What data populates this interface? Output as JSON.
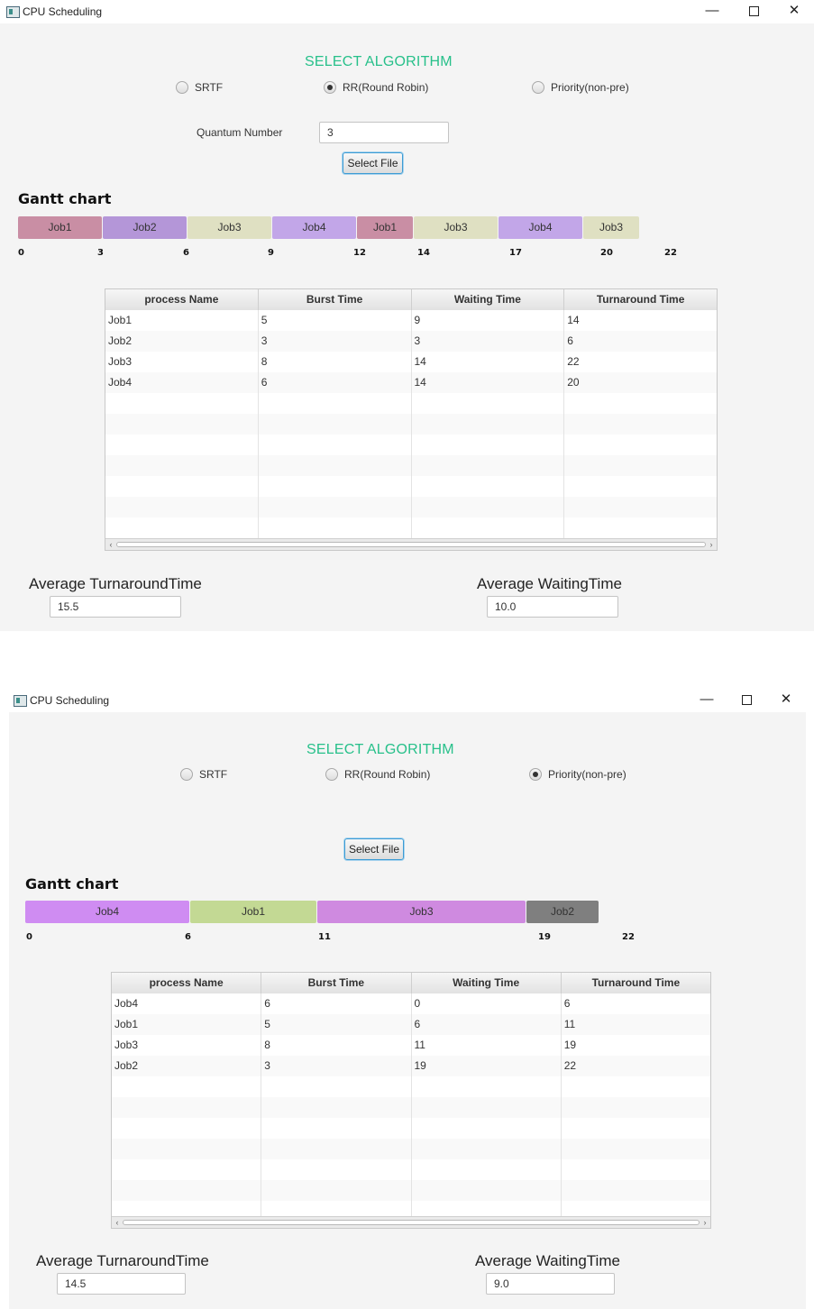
{
  "windows": [
    {
      "title": "CPU Scheduling",
      "select_title": "SELECT ALGORITHM",
      "radios": [
        {
          "label": "SRTF",
          "selected": false
        },
        {
          "label": "RR(Round Robin)",
          "selected": true
        },
        {
          "label": "Priority(non-pre)",
          "selected": false
        }
      ],
      "quantum_label": "Quantum Number",
      "quantum_value": "3",
      "select_file_label": "Select File",
      "gantt_title": "Gantt chart",
      "gantt_blocks": [
        "Job1",
        "Job2",
        "Job3",
        "Job4",
        "Job1",
        "Job3",
        "Job4",
        "Job3"
      ],
      "gantt_ticks": [
        "0",
        "3",
        "6",
        "9",
        "12",
        "14",
        "17",
        "20",
        "22"
      ],
      "table_headers": [
        "process Name",
        "Burst Time",
        "Waiting Time",
        "Turnaround Time"
      ],
      "table_rows": [
        [
          "Job1",
          "5",
          "9",
          "14"
        ],
        [
          "Job2",
          "3",
          "3",
          "6"
        ],
        [
          "Job3",
          "8",
          "14",
          "22"
        ],
        [
          "Job4",
          "6",
          "14",
          "20"
        ]
      ],
      "avg_turnaround_label": "Average TurnaroundTime",
      "avg_turnaround_value": "15.5",
      "avg_waiting_label": "Average WaitingTime",
      "avg_waiting_value": "10.0"
    },
    {
      "title": "CPU Scheduling",
      "select_title": "SELECT ALGORITHM",
      "radios": [
        {
          "label": "SRTF",
          "selected": false
        },
        {
          "label": "RR(Round Robin)",
          "selected": false
        },
        {
          "label": "Priority(non-pre)",
          "selected": true
        }
      ],
      "select_file_label": "Select File",
      "gantt_title": "Gantt chart",
      "gantt_blocks": [
        "Job4",
        "Job1",
        "Job3",
        "Job2"
      ],
      "gantt_ticks": [
        "0",
        "6",
        "11",
        "19",
        "22"
      ],
      "table_headers": [
        "process Name",
        "Burst Time",
        "Waiting Time",
        "Turnaround Time"
      ],
      "table_rows": [
        [
          "Job4",
          "6",
          "0",
          "6"
        ],
        [
          "Job1",
          "5",
          "6",
          "11"
        ],
        [
          "Job3",
          "8",
          "11",
          "19"
        ],
        [
          "Job2",
          "3",
          "19",
          "22"
        ]
      ],
      "avg_turnaround_label": "Average TurnaroundTime",
      "avg_turnaround_value": "14.5",
      "avg_waiting_label": "Average WaitingTime",
      "avg_waiting_value": "9.0"
    }
  ],
  "colors": {
    "accent_title": "#27c08a",
    "focus_border": "#3c9bd4",
    "win1_gantt": [
      "#c98ea4",
      "#b496d8",
      "#dfe0c2",
      "#c2a6e8",
      "#c98ea4",
      "#dfe0c2",
      "#c2a6e8",
      "#dfe0c2"
    ],
    "win2_gantt": [
      "#cf8cf2",
      "#c3d994",
      "#cf8ae0",
      "#7f7f7f"
    ]
  },
  "icons": [
    "app-icon",
    "minimize-icon",
    "maximize-icon",
    "close-icon"
  ]
}
